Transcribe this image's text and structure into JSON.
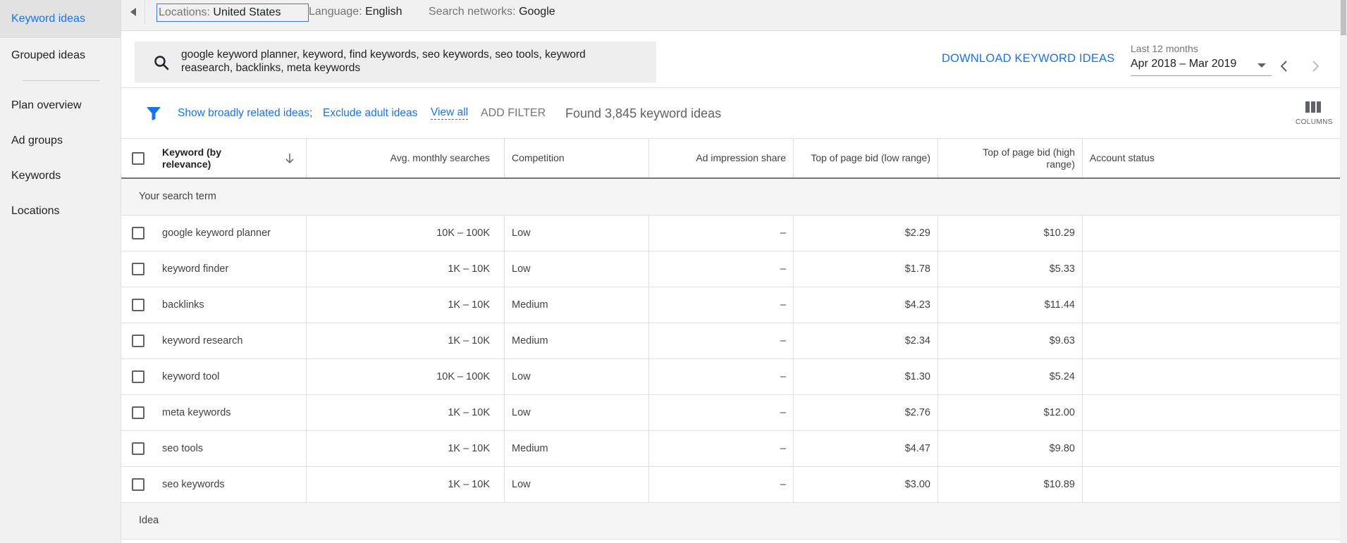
{
  "sidebar": {
    "items": [
      {
        "label": "Keyword ideas"
      },
      {
        "label": "Grouped ideas"
      },
      {
        "label": "Plan overview"
      },
      {
        "label": "Ad groups"
      },
      {
        "label": "Keywords"
      },
      {
        "label": "Locations"
      }
    ]
  },
  "topbar": {
    "locations_key": "Locations:",
    "locations_value": "United States",
    "language_key": "Language:",
    "language_value": "English",
    "networks_key": "Search networks:",
    "networks_value": "Google"
  },
  "search": {
    "value": "google keyword planner, keyword, find keywords, seo keywords, seo tools, keyword reasearch, backlinks, meta keywords"
  },
  "download_label": "DOWNLOAD KEYWORD IDEAS",
  "date": {
    "label": "Last 12 months",
    "value": "Apr 2018 – Mar 2019"
  },
  "filters": {
    "broad": "Show broadly related ideas;",
    "adult": "Exclude adult ideas",
    "view_all": "View all",
    "add_filter": "ADD FILTER",
    "found": "Found 3,845 keyword ideas",
    "columns": "COLUMNS"
  },
  "table": {
    "headers": {
      "keyword": "Keyword (by relevance)",
      "avg": "Avg. monthly searches",
      "competition": "Competition",
      "impression": "Ad impression share",
      "low_bid": "Top of page bid (low range)",
      "high_bid": "Top of page bid (high range)",
      "account": "Account status"
    },
    "group_search_term": "Your search term",
    "group_idea": "Idea",
    "rows": [
      {
        "keyword": "google keyword planner",
        "avg": "10K – 100K",
        "competition": "Low",
        "impression": "–",
        "low": "$2.29",
        "high": "$10.29",
        "account": ""
      },
      {
        "keyword": "keyword finder",
        "avg": "1K – 10K",
        "competition": "Low",
        "impression": "–",
        "low": "$1.78",
        "high": "$5.33",
        "account": ""
      },
      {
        "keyword": "backlinks",
        "avg": "1K – 10K",
        "competition": "Medium",
        "impression": "–",
        "low": "$4.23",
        "high": "$11.44",
        "account": ""
      },
      {
        "keyword": "keyword research",
        "avg": "1K – 10K",
        "competition": "Medium",
        "impression": "–",
        "low": "$2.34",
        "high": "$9.63",
        "account": ""
      },
      {
        "keyword": "keyword tool",
        "avg": "10K – 100K",
        "competition": "Low",
        "impression": "–",
        "low": "$1.30",
        "high": "$5.24",
        "account": ""
      },
      {
        "keyword": "meta keywords",
        "avg": "1K – 10K",
        "competition": "Low",
        "impression": "–",
        "low": "$2.76",
        "high": "$12.00",
        "account": ""
      },
      {
        "keyword": "seo tools",
        "avg": "1K – 10K",
        "competition": "Medium",
        "impression": "–",
        "low": "$4.47",
        "high": "$9.80",
        "account": ""
      },
      {
        "keyword": "seo keywords",
        "avg": "1K – 10K",
        "competition": "Low",
        "impression": "–",
        "low": "$3.00",
        "high": "$10.89",
        "account": ""
      }
    ]
  },
  "colors": {
    "accent": "#1a73e8",
    "sidebar_bg": "#f1f1f1",
    "group_bg": "#f5f5f5"
  }
}
